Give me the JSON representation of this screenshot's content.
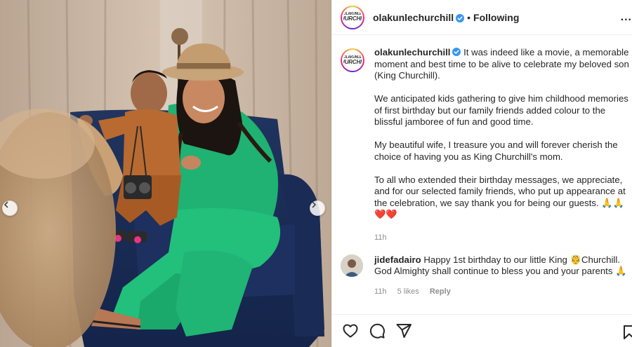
{
  "post": {
    "username": "olakunlechurchill",
    "verified": true,
    "separator": "•",
    "follow_status": "Following",
    "more_label": "...",
    "avatar_logo_top": "OLAKUNLE",
    "avatar_logo_main": "CHURCHILL"
  },
  "caption": {
    "author": "olakunlechurchill",
    "paragraphs": [
      "It was indeed like a movie, a memorable moment and best time to be alive to celebrate my beloved son (King Churchill).",
      "We anticipated kids gathering to give him childhood memories of first birthday but our family friends added colour to the blissful jamboree of fun and good time.",
      "My beautiful wife, I treasure you and will forever cherish the choice of having you as King Churchill's mom.",
      "To all who extended their birthday messages, we appreciate, and for our selected family friends, who put up appearance at the celebration, we say thank you for being our guests. 🙏🙏 ❤️❤️"
    ],
    "time": "11h"
  },
  "comments": [
    {
      "author": "jidefadairo",
      "text": "Happy 1st birthday to our little King 🤴Churchill. God Almighty shall continue to bless you and your parents 🙏",
      "time": "11h",
      "likes": "5 likes",
      "reply_label": "Reply"
    }
  ],
  "icons": {
    "like": "heart-outline-icon",
    "comment": "speech-bubble-icon",
    "share": "paper-plane-icon",
    "save": "bookmark-icon",
    "prev": "chevron-left-icon",
    "next": "chevron-right-icon"
  },
  "colors": {
    "verified": "#3897f0",
    "meta": "#8e8e8e",
    "text": "#262626",
    "border": "#efefef"
  }
}
